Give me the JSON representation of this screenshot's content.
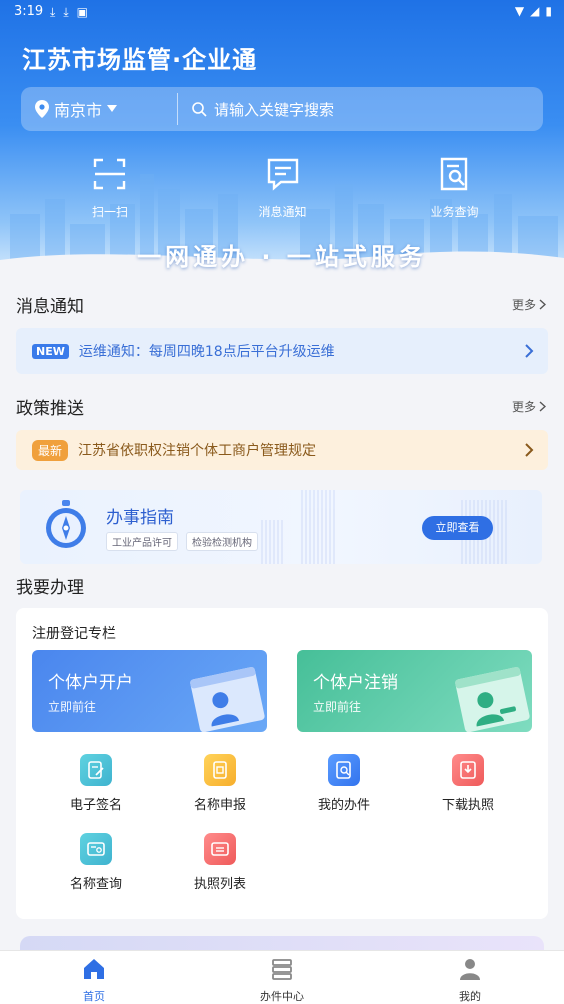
{
  "status_bar": {
    "time": "3:19"
  },
  "header": {
    "app_title": "江苏市场监管·企业通"
  },
  "search": {
    "city": "南京市",
    "placeholder": "请输入关键字搜索"
  },
  "quick_actions": [
    {
      "label": "扫一扫",
      "icon": "scan-icon"
    },
    {
      "label": "消息通知",
      "icon": "message-icon"
    },
    {
      "label": "业务查询",
      "icon": "business-query-icon"
    }
  ],
  "slogan": "一网通办 · 一站式服务",
  "notice_section": {
    "title": "消息通知",
    "more": "更多",
    "badge": "NEW",
    "text": "运维通知：每周四晚18点后平台升级运维"
  },
  "policy_section": {
    "title": "政策推送",
    "more": "更多",
    "badge": "最新",
    "text": "江苏省依职权注销个体工商户管理规定"
  },
  "guide": {
    "title": "办事指南",
    "tags": [
      "工业产品许可",
      "检验检测机构"
    ],
    "button": "立即查看"
  },
  "todo_section": {
    "title": "我要办理"
  },
  "registration": {
    "title": "注册登记专栏",
    "open": {
      "title": "个体户开户",
      "subtitle": "立即前往"
    },
    "close": {
      "title": "个体户注销",
      "subtitle": "立即前往"
    },
    "items": [
      {
        "label": "电子签名",
        "icon": "e-signature-icon"
      },
      {
        "label": "名称申报",
        "icon": "name-declare-icon"
      },
      {
        "label": "我的办件",
        "icon": "my-cases-icon"
      },
      {
        "label": "下载执照",
        "icon": "download-license-icon"
      },
      {
        "label": "名称查询",
        "icon": "name-query-icon"
      },
      {
        "label": "执照列表",
        "icon": "license-list-icon"
      }
    ]
  },
  "nav": {
    "home": "首页",
    "center": "办件中心",
    "mine": "我的"
  },
  "colors": {
    "primary": "#2f6fe4",
    "hero_top": "#1f72e6",
    "notice_bg": "#e6effc",
    "policy_bg": "#fdf0dd",
    "latest_badge": "#f0a03c"
  }
}
